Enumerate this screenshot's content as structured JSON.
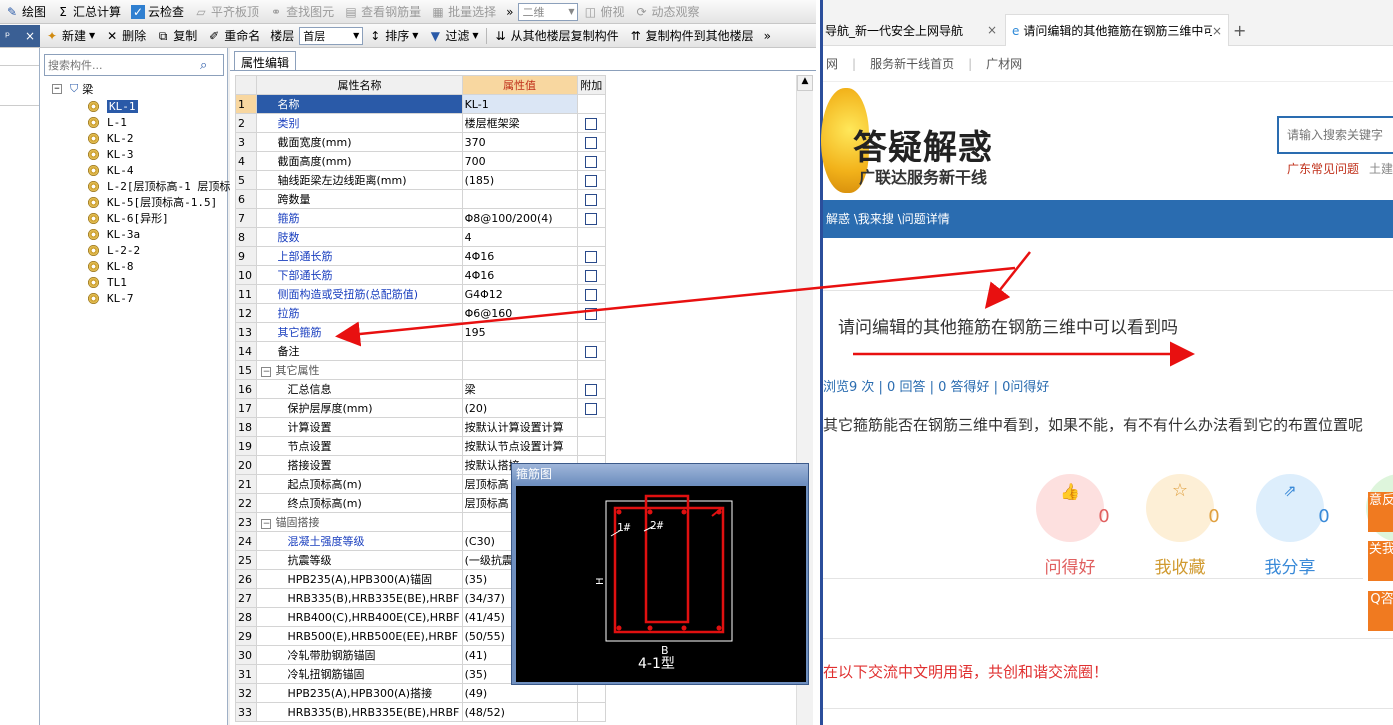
{
  "toolbar1": {
    "draw": "绘图",
    "sum": "汇总计算",
    "cloud": "云检查",
    "flat": "平齐板顶",
    "find": "查找图元",
    "view_steel": "查看钢筋量",
    "batch": "批量选择",
    "more": "»",
    "dim": "二维",
    "fuview": "俯视",
    "dynamic": "动态观察"
  },
  "toolbar2": {
    "pin": "ᵖ",
    "close": "×",
    "new": "新建",
    "del": "删除",
    "copy": "复制",
    "rename": "重命名",
    "floor_label": "楼层",
    "floor_value": "首层",
    "sort": "排序",
    "filter": "过滤",
    "copy_from": "从其他楼层复制构件",
    "copy_to": "复制构件到其他楼层",
    "more": "»"
  },
  "search": {
    "placeholder": "搜索构件..."
  },
  "tree": {
    "root": "梁",
    "items": [
      "KL-1",
      "L-1",
      "KL-2",
      "KL-3",
      "KL-4",
      "L-2[层顶标高-1 层顶标",
      "KL-5[层顶标高-1.5]",
      "KL-6[异形]",
      "KL-3a",
      "L-2-2",
      "KL-8",
      "TL1",
      "KL-7"
    ]
  },
  "props": {
    "tab": "属性编辑",
    "col_name": "属性名称",
    "col_value": "属性值",
    "col_add": "附加",
    "rows": [
      {
        "n": "1",
        "name": "名称",
        "val": "KL-1",
        "cb": false,
        "blue": true
      },
      {
        "n": "2",
        "name": "类别",
        "val": "楼层框架梁",
        "cb": true,
        "blue": true
      },
      {
        "n": "3",
        "name": "截面宽度(mm)",
        "val": "370",
        "cb": true,
        "blue": false
      },
      {
        "n": "4",
        "name": "截面高度(mm)",
        "val": "700",
        "cb": true,
        "blue": false
      },
      {
        "n": "5",
        "name": "轴线距梁左边线距离(mm)",
        "val": "(185)",
        "cb": true,
        "blue": false
      },
      {
        "n": "6",
        "name": "跨数量",
        "val": "",
        "cb": true,
        "blue": false
      },
      {
        "n": "7",
        "name": "箍筋",
        "val": "Φ8@100/200(4)",
        "cb": true,
        "blue": true
      },
      {
        "n": "8",
        "name": "肢数",
        "val": "4",
        "cb": false,
        "blue": true
      },
      {
        "n": "9",
        "name": "上部通长筋",
        "val": "4Φ16",
        "cb": true,
        "blue": true
      },
      {
        "n": "10",
        "name": "下部通长筋",
        "val": "4Φ16",
        "cb": true,
        "blue": true
      },
      {
        "n": "11",
        "name": "侧面构造或受扭筋(总配筋值)",
        "val": "G4Φ12",
        "cb": true,
        "blue": true
      },
      {
        "n": "12",
        "name": "拉筋",
        "val": "Φ6@160",
        "cb": true,
        "blue": true
      },
      {
        "n": "13",
        "name": "其它箍筋",
        "val": "195",
        "cb": false,
        "blue": true
      },
      {
        "n": "14",
        "name": "备注",
        "val": "",
        "cb": true,
        "blue": false
      },
      {
        "n": "15",
        "name": "其它属性",
        "val": "",
        "cb": false,
        "blue": false,
        "group": true
      },
      {
        "n": "16",
        "name": "汇总信息",
        "val": "梁",
        "cb": true,
        "blue": false,
        "sub": true
      },
      {
        "n": "17",
        "name": "保护层厚度(mm)",
        "val": "(20)",
        "cb": true,
        "blue": false,
        "sub": true
      },
      {
        "n": "18",
        "name": "计算设置",
        "val": "按默认计算设置计算",
        "cb": false,
        "blue": false,
        "sub": true
      },
      {
        "n": "19",
        "name": "节点设置",
        "val": "按默认节点设置计算",
        "cb": false,
        "blue": false,
        "sub": true
      },
      {
        "n": "20",
        "name": "搭接设置",
        "val": "按默认搭接",
        "cb": false,
        "blue": false,
        "sub": true
      },
      {
        "n": "21",
        "name": "起点顶标高(m)",
        "val": "层顶标高",
        "cb": false,
        "blue": false,
        "sub": true
      },
      {
        "n": "22",
        "name": "终点顶标高(m)",
        "val": "层顶标高",
        "cb": false,
        "blue": false,
        "sub": true
      },
      {
        "n": "23",
        "name": "锚固搭接",
        "val": "",
        "cb": false,
        "blue": false,
        "group": true
      },
      {
        "n": "24",
        "name": "混凝土强度等级",
        "val": "(C30)",
        "cb": false,
        "blue": true,
        "sub": true
      },
      {
        "n": "25",
        "name": "抗震等级",
        "val": "(一级抗震)",
        "cb": false,
        "blue": false,
        "sub": true
      },
      {
        "n": "26",
        "name": "HPB235(A),HPB300(A)锚固",
        "val": "(35)",
        "cb": false,
        "blue": false,
        "sub": true
      },
      {
        "n": "27",
        "name": "HRB335(B),HRB335E(BE),HRBF",
        "val": "(34/37)",
        "cb": false,
        "blue": false,
        "sub": true
      },
      {
        "n": "28",
        "name": "HRB400(C),HRB400E(CE),HRBF",
        "val": "(41/45)",
        "cb": false,
        "blue": false,
        "sub": true
      },
      {
        "n": "29",
        "name": "HRB500(E),HRB500E(EE),HRBF",
        "val": "(50/55)",
        "cb": false,
        "blue": false,
        "sub": true
      },
      {
        "n": "30",
        "name": "冷轧带肋钢筋锚固",
        "val": "(41)",
        "cb": false,
        "blue": false,
        "sub": true
      },
      {
        "n": "31",
        "name": "冷轧扭钢筋锚固",
        "val": "(35)",
        "cb": false,
        "blue": false,
        "sub": true
      },
      {
        "n": "32",
        "name": "HPB235(A),HPB300(A)搭接",
        "val": "(49)",
        "cb": false,
        "blue": false,
        "sub": true
      },
      {
        "n": "33",
        "name": "HRB335(B),HRB335E(BE),HRBF",
        "val": "(48/52)",
        "cb": false,
        "blue": false,
        "sub": true
      }
    ]
  },
  "popup": {
    "title": "箍筋图",
    "label1": "1#",
    "label2": "2#",
    "label_h": "H",
    "label_b": "B",
    "type": "4-1型"
  },
  "browser": {
    "tab1": "导航_新一代安全上网导航",
    "tab2": "请问编辑的其他箍筋在钢筋三维中可",
    "close": "×",
    "plus": "+",
    "links": [
      "网",
      "|",
      "服务新干线首页",
      "|",
      "广材网"
    ],
    "logo_title": "答疑解惑",
    "logo_sub": "广联达服务新干线",
    "search_placeholder": "请输入搜索关键字",
    "hot": "广东常见问题",
    "hot2": "土建",
    "nav": "解惑 \\我来搜 \\问题详情",
    "question": "请问编辑的其他箍筋在钢筋三维中可以看到吗",
    "stats": "浏览9 次 | 0 回答 | 0 答得好 | 0问得好",
    "desc": "其它箍筋能否在钢筋三维中看到，如果不能，有不有什么办法看到它的布置位置呢",
    "btn_good": "问得好",
    "btn_fav": "我收藏",
    "btn_share": "我分享",
    "count_good": "0",
    "count_fav": "0",
    "count_share": "0",
    "side1": "意反",
    "side2": "关我",
    "side3": "Q咨",
    "footer": "在以下交流中文明用语，共创和谐交流圈！"
  }
}
